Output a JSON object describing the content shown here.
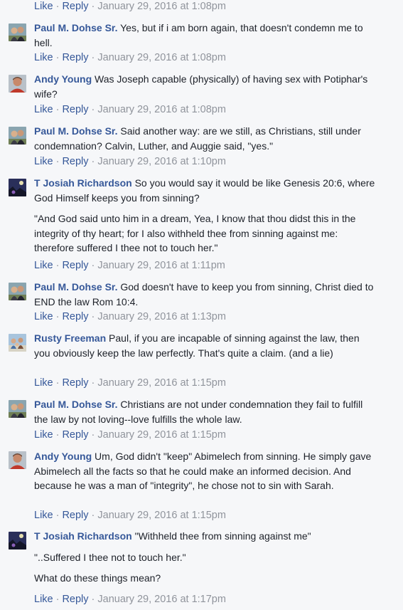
{
  "labels": {
    "like": "Like",
    "reply": "Reply",
    "sep": "·"
  },
  "top_timestamp": "January 29, 2016 at 1:08pm",
  "comments": [
    {
      "author": "Paul M. Dohse Sr.",
      "avatar": "couple-avatar",
      "paragraphs": [
        "Yes, but if i am born again, that doesn't condemn me to hell."
      ],
      "timestamp": "January 29, 2016 at 1:08pm"
    },
    {
      "author": "Andy Young",
      "avatar": "man-portrait-avatar",
      "paragraphs": [
        "Was Joseph capable (physically) of having sex with Potiphar's wife?"
      ],
      "timestamp": "January 29, 2016 at 1:08pm"
    },
    {
      "author": "Paul M. Dohse Sr.",
      "avatar": "couple-avatar",
      "paragraphs": [
        "Said another way: are we still, as Christians, still under condemnation? Calvin, Luther, and Auggie said, \"yes.\""
      ],
      "timestamp": "January 29, 2016 at 1:10pm"
    },
    {
      "author": "T Josiah Richardson",
      "avatar": "night-scene-avatar",
      "paragraphs": [
        "So you would say it would be like Genesis 20:6, where God Himself keeps you from sinning?",
        "\"And God said unto him in a dream, Yea, I know that thou didst this in the integrity of thy heart; for I also withheld thee from sinning against me: therefore suffered I thee not to touch her.\""
      ],
      "timestamp": "January 29, 2016 at 1:11pm"
    },
    {
      "author": "Paul M. Dohse Sr.",
      "avatar": "couple-avatar",
      "paragraphs": [
        "God doesn't have to keep you from sinning, Christ died to END the law Rom 10:4."
      ],
      "timestamp": "January 29, 2016 at 1:13pm"
    },
    {
      "author": "Rusty Freeman",
      "avatar": "family-avatar",
      "paragraphs": [
        "Paul, if you are incapable of sinning against the law, then you obviously keep the law perfectly. That's quite a claim. (and a lie)"
      ],
      "timestamp": "January 29, 2016 at 1:15pm"
    },
    {
      "author": "Paul M. Dohse Sr.",
      "avatar": "couple-avatar",
      "paragraphs": [
        "Christians are not under condemnation they fail to fulfill the law by not loving--love fulfills the whole law."
      ],
      "timestamp": "January 29, 2016 at 1:15pm"
    },
    {
      "author": "Andy Young",
      "avatar": "man-portrait-avatar",
      "paragraphs": [
        "Um, God didn't \"keep\" Abimelech from sinning. He simply gave Abimelech all the facts so that he could make an informed decision. And because he was a man of \"integrity\", he chose not to sin with Sarah."
      ],
      "timestamp": "January 29, 2016 at 1:15pm"
    },
    {
      "author": "T Josiah Richardson",
      "avatar": "night-scene-avatar",
      "paragraphs": [
        "\"Withheld thee from sinning against me\"",
        "\"..Suffered I thee not to touch her.\"",
        "What do these things mean?"
      ],
      "timestamp": "January 29, 2016 at 1:17pm"
    }
  ]
}
